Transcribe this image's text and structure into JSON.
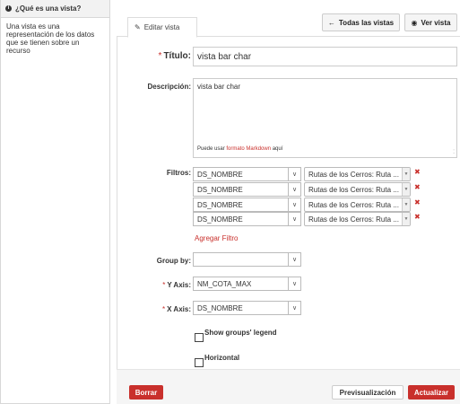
{
  "info": {
    "icon": "info-circle-icon",
    "title": "¿Qué es una vista?",
    "body": "Una vista es una representación de los datos que se tienen sobre un recurso"
  },
  "tabs": {
    "edit_label": "Editar vista",
    "edit_icon": "pencil-icon"
  },
  "top_buttons": {
    "all_views": "Todas las vistas",
    "all_views_icon": "arrow-left-icon",
    "view": "Ver vista",
    "view_icon": "eye-icon"
  },
  "form": {
    "title_label": "Título:",
    "title_value": "vista bar char",
    "description_label": "Descripción:",
    "description_value": "vista bar char",
    "markdown_hint_pre": "Puede usar ",
    "markdown_hint_link": "formato Markdown",
    "markdown_hint_post": " aquí",
    "filters_label": "Filtros:",
    "filters": [
      {
        "field": "DS_NOMBRE",
        "value": "Rutas de los Cerros: Ruta ..."
      },
      {
        "field": "DS_NOMBRE",
        "value": "Rutas de los Cerros: Ruta ..."
      },
      {
        "field": "DS_NOMBRE",
        "value": "Rutas de los Cerros: Ruta ..."
      },
      {
        "field": "DS_NOMBRE",
        "value": "Rutas de los Cerros: Ruta ..."
      }
    ],
    "add_filter": "Agregar Filtro",
    "group_by_label": "Group by:",
    "group_by_value": "",
    "y_axis_label": "Y Axis:",
    "y_axis_value": "NM_COTA_MAX",
    "x_axis_label": "X Axis:",
    "x_axis_value": "DS_NOMBRE",
    "show_legend_label": "Show groups' legend",
    "horizontal_label": "Horizontal"
  },
  "footer": {
    "delete": "Borrar",
    "preview": "Previsualización",
    "update": "Actualizar"
  },
  "colors": {
    "accent": "#c9302c"
  }
}
